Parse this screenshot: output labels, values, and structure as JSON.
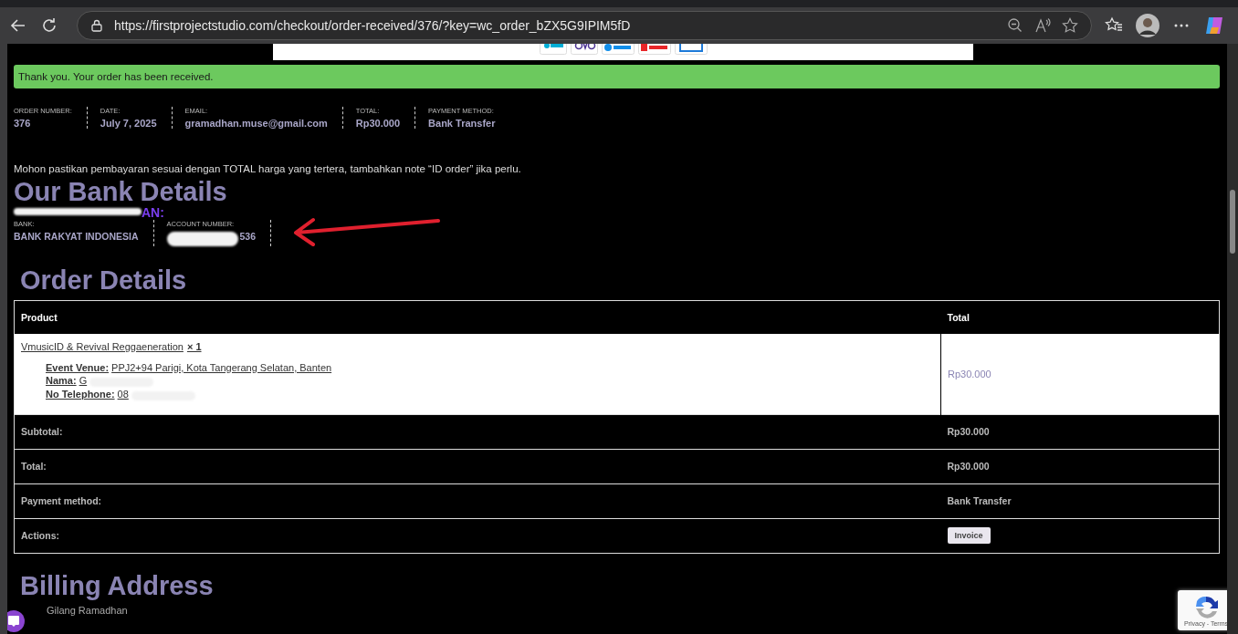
{
  "browser": {
    "url": "https://firstprojectstudio.com/checkout/order-received/376/?key=wc_order_bZX5G9IPIM5fD"
  },
  "notice": "Thank you. Your order has been received.",
  "overview": [
    {
      "label": "ORDER NUMBER:",
      "value": "376"
    },
    {
      "label": "DATE:",
      "value": "July 7, 2025"
    },
    {
      "label": "EMAIL:",
      "value": "gramadhan.muse@gmail.com"
    },
    {
      "label": "TOTAL:",
      "value": "Rp30.000"
    },
    {
      "label": "PAYMENT METHOD:",
      "value": "Bank Transfer"
    }
  ],
  "instruction": "Mohon pastikan pembayaran sesuai dengan TOTAL harga yang tertera, tambahkan note “ID order” jika perlu.",
  "bank_details": {
    "title": "Our Bank Details",
    "account_name": "AN:",
    "fields": [
      {
        "label": "BANK:",
        "value": "BANK RAKYAT INDONESIA"
      },
      {
        "label": "ACCOUNT NUMBER:",
        "value": "536"
      }
    ]
  },
  "order_details": {
    "title": "Order Details",
    "columns": [
      "Product",
      "Total"
    ],
    "item": {
      "name": "VmusicID & Revival Reggaeneration",
      "quantity": "× 1",
      "total": "Rp30.000",
      "meta": [
        {
          "label": "Event Venue:",
          "value": "PPJ2+94 Parigi, Kota Tangerang Selatan, Banten"
        },
        {
          "label": "Nama:",
          "value": "G"
        },
        {
          "label": "No Telephone:",
          "value": "08"
        }
      ]
    },
    "totals": [
      {
        "label": "Subtotal:",
        "kind": "text",
        "value": "Rp30.000"
      },
      {
        "label": "Total:",
        "kind": "text",
        "value": "Rp30.000"
      },
      {
        "label": "Payment method:",
        "kind": "text",
        "value": "Bank Transfer"
      },
      {
        "label": "Actions:",
        "kind": "button",
        "value": "Invoice"
      }
    ]
  },
  "billing": {
    "title": "Billing Address",
    "name": "Gilang Ramadhan"
  },
  "recaptcha": {
    "links": "Privacy - Terms"
  }
}
